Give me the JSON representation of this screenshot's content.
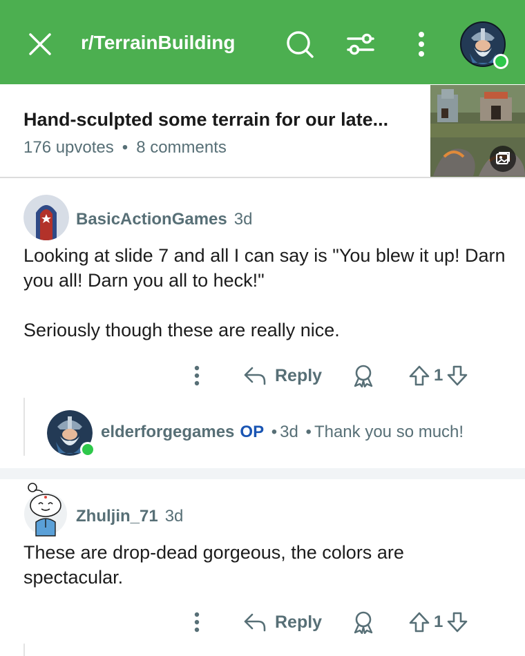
{
  "header": {
    "subreddit": "r/TerrainBuilding",
    "close_icon": "close-icon",
    "search_icon": "search-icon",
    "filter_icon": "sort-filter-icon",
    "more_icon": "more-vertical-icon",
    "accent_color": "#4caf50"
  },
  "post": {
    "title": "Hand-sculpted some terrain for our late...",
    "upvotes": "176 upvotes",
    "separator": "•",
    "comments": "8 comments",
    "thumb_badge_icon": "gallery-icon"
  },
  "comments": [
    {
      "author": "BasicActionGames",
      "time": "3d",
      "body": [
        "Looking at slide 7 and all I can say is \"You blew it up! Darn you all! Darn you all to heck!\"",
        "Seriously though these are really nice."
      ],
      "reply_label": "Reply",
      "votes": "1",
      "replies": [
        {
          "author": "elderforgegames",
          "badge": "OP",
          "dot1": "•",
          "time": "3d",
          "dot2": "•",
          "text": "Thank you so much!"
        }
      ]
    },
    {
      "author": "Zhuljin_71",
      "time": "3d",
      "body": [
        "These are drop-dead gorgeous, the colors are spectacular."
      ],
      "reply_label": "Reply",
      "votes": "1"
    }
  ]
}
